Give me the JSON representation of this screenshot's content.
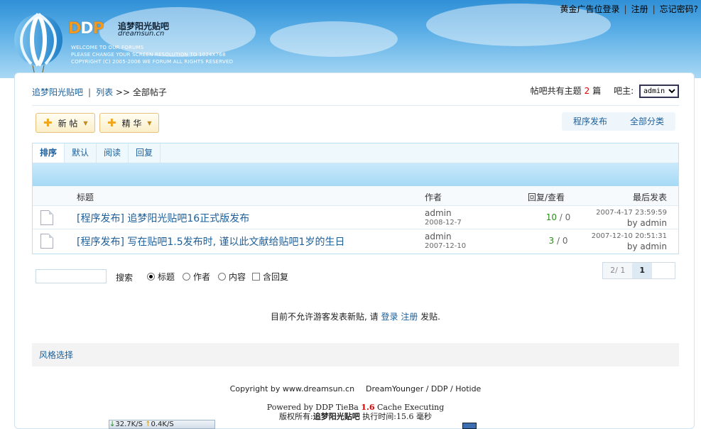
{
  "header": {
    "logo_ddp": [
      "D",
      "D",
      "P"
    ],
    "site_name": "追梦阳光贴吧",
    "domain": "dreamsun.cn",
    "welcome_lines": [
      "WELCOME TO OUR FORUMS",
      "PLEASE CHANGE YOUR SCREEN RESOLUTION TO 1024X768",
      "COPYRIGHT (C) 2005-2006 WE FORUM ALL RIGHTS RESERVED"
    ],
    "toplinks": {
      "ad_label": "黄金广告位",
      "login": "登录",
      "register": "注册",
      "forgot": "忘记密码?"
    }
  },
  "breadcrumb": {
    "home": "追梦阳光贴吧",
    "list": "列表",
    "current": "全部帖子"
  },
  "stats": {
    "prefix": "帖吧共有主题",
    "count": "2",
    "suffix": "篇",
    "owner_label": "吧主:",
    "owner_selected": "admin"
  },
  "buttons": {
    "new_post": "新 帖",
    "essence": "精 华"
  },
  "right_tabs": [
    "程序发布",
    "全部分类"
  ],
  "sort_tabs": [
    "排序",
    "默认",
    "阅读",
    "回复"
  ],
  "table": {
    "headers": {
      "title": "标题",
      "author": "作者",
      "replies": "回复/查看",
      "last": "最后发表"
    },
    "rows": [
      {
        "title": "[程序发布] 追梦阳光贴吧16正式版发布",
        "author": "admin",
        "date": "2008-12-7",
        "replies": "10",
        "views": "0",
        "last_time": "2007-4-17 23:59:59",
        "last_by": "by admin"
      },
      {
        "title": "[程序发布] 写在贴吧1.5发布时, 谨以此文献给贴吧1岁的生日",
        "author": "admin",
        "date": "2007-12-10",
        "replies": "3",
        "views": "0",
        "last_time": "2007-12-10 20:51:31",
        "last_by": "by admin"
      }
    ]
  },
  "search": {
    "input_value": "",
    "button": "搜索",
    "options": [
      "标题",
      "作者",
      "内容"
    ],
    "selected_option": "标题",
    "checkbox_label": "含回复"
  },
  "pager": {
    "info": "2/ 1",
    "current": "1"
  },
  "notice": {
    "prefix": "目前不允许游客发表新贴, 请",
    "login": "登录",
    "register": "注册",
    "suffix": "发贴."
  },
  "style_select": "风格选择",
  "footer": {
    "copyright": "Copyright by www.dreamsun.cn",
    "credits": "DreamYounger / DDP / Hotide",
    "powered_prefix": "Powered by DDP TieBa",
    "version": "1.6",
    "powered_suffix": "Cache Executing",
    "rights_prefix": "版权所有:",
    "rights_name": "追梦阳光贴吧",
    "exec_label": "执行时间:",
    "exec_time": "15.6 毫秒"
  },
  "taskbar": {
    "down": "32.7K/S",
    "up": "0.4K/S"
  },
  "colors": {
    "link": "#1c5f9a",
    "header_blue": "#2f8fd6",
    "accent_orange": "#f2a419",
    "reply_green": "#2e8b1f",
    "count_red": "#dd0000"
  }
}
